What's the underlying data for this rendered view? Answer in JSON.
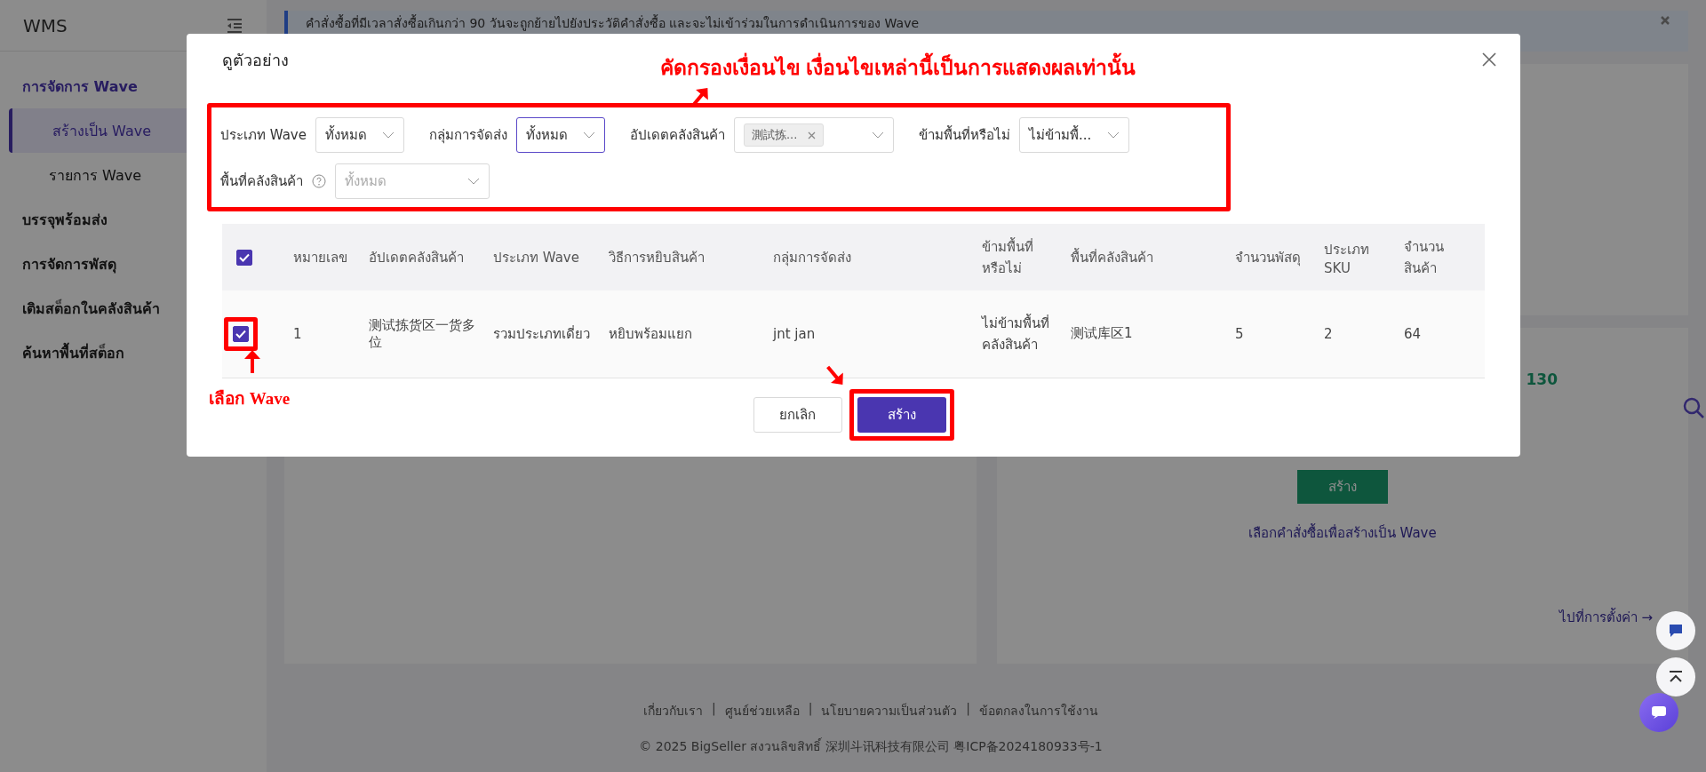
{
  "sidebar": {
    "title": "WMS",
    "items": [
      {
        "label": "การจัดการ Wave",
        "selected": false,
        "children": [
          {
            "label": "สร้างเป็น Wave",
            "selected": true
          },
          {
            "label": "รายการ Wave",
            "selected": false
          }
        ]
      },
      {
        "label": "บรรจุพร้อมส่ง",
        "selected": false
      },
      {
        "label": "การจัดการพัสดุ",
        "selected": false
      },
      {
        "label": "เติมสต็อกในคลังสินค้า",
        "selected": false
      },
      {
        "label": "ค้นหาพื้นที่สต็อก",
        "selected": false
      }
    ]
  },
  "banner": {
    "text": "คำสั่งซื้อที่มีเวลาสั่งซื้อเกินกว่า 90 วันจะถูกย้ายไปยังประวัติคำสั่งซื้อ และจะไม่เข้าร่วมในการดำเนินการของ Wave"
  },
  "right_card": {
    "count": "130",
    "button": "สร้าง",
    "hint": "เลือกคำสั่งซื้อเพื่อสร้างเป็น Wave",
    "settings_link": "ไปที่การตั้งค่า →"
  },
  "footer": {
    "links": [
      "เกี่ยวกับเรา",
      "ศูนย์ช่วยเหลือ",
      "นโยบายความเป็นส่วนตัว",
      "ข้อตกลงในการใช้งาน"
    ],
    "separator": "|",
    "copyright": "© 2025 BigSeller สงวนลิขสิทธิ์   深圳斗讯科技有限公司   粤ICP备2024180933号-1"
  },
  "modal": {
    "title": "ดูตัวอย่าง",
    "filter_note": "คัดกรองเงื่อนไข เงื่อนไขเหล่านี้เป็นการแสดงผลเท่านั้น",
    "checkbox_note": "เลือก Wave",
    "filters": [
      {
        "kind": "select",
        "label": "ประเภท Wave",
        "value": "ทั้งหมด",
        "focused": false
      },
      {
        "kind": "select",
        "label": "กลุ่มการจัดส่ง",
        "value": "ทั้งหมด",
        "focused": true
      },
      {
        "kind": "tags",
        "label": "อัปเดตคลังสินค้า",
        "tags": [
          "測試拣..."
        ],
        "focused": false
      },
      {
        "kind": "select",
        "label": "ข้ามพื้นที่หรือไม่",
        "value": "ไม่ข้ามพื้...",
        "focused": false
      },
      {
        "kind": "select",
        "label": "พื้นที่คลังสินค้า",
        "placeholder": "ทั้งหมด",
        "focused": false,
        "help": true
      }
    ],
    "table": {
      "header_checked": true,
      "columns": [
        "หมายเลข",
        "อัปเดตคลังสินค้า",
        "ประเภท Wave",
        "วิธีการหยิบสินค้า",
        "กลุ่มการจัดส่ง",
        "ข้ามพื้นที่หรือไม่",
        "พื้นที่คลังสินค้า",
        "จำนวนพัสดุ",
        "ประเภท SKU",
        "จำนวนสินค้า"
      ],
      "rows": [
        {
          "checked": true,
          "cells": [
            "1",
            "测试拣货区一货多位",
            "รวมประเภทเดี่ยว",
            "หยิบพร้อมแยก",
            "jnt jan",
            "ไม่ข้ามพื้นที่คลังสินค้า",
            "测试库区1",
            "5",
            "2",
            "64"
          ]
        }
      ]
    },
    "buttons": {
      "cancel": "ยกเลิก",
      "create": "สร้าง"
    }
  }
}
